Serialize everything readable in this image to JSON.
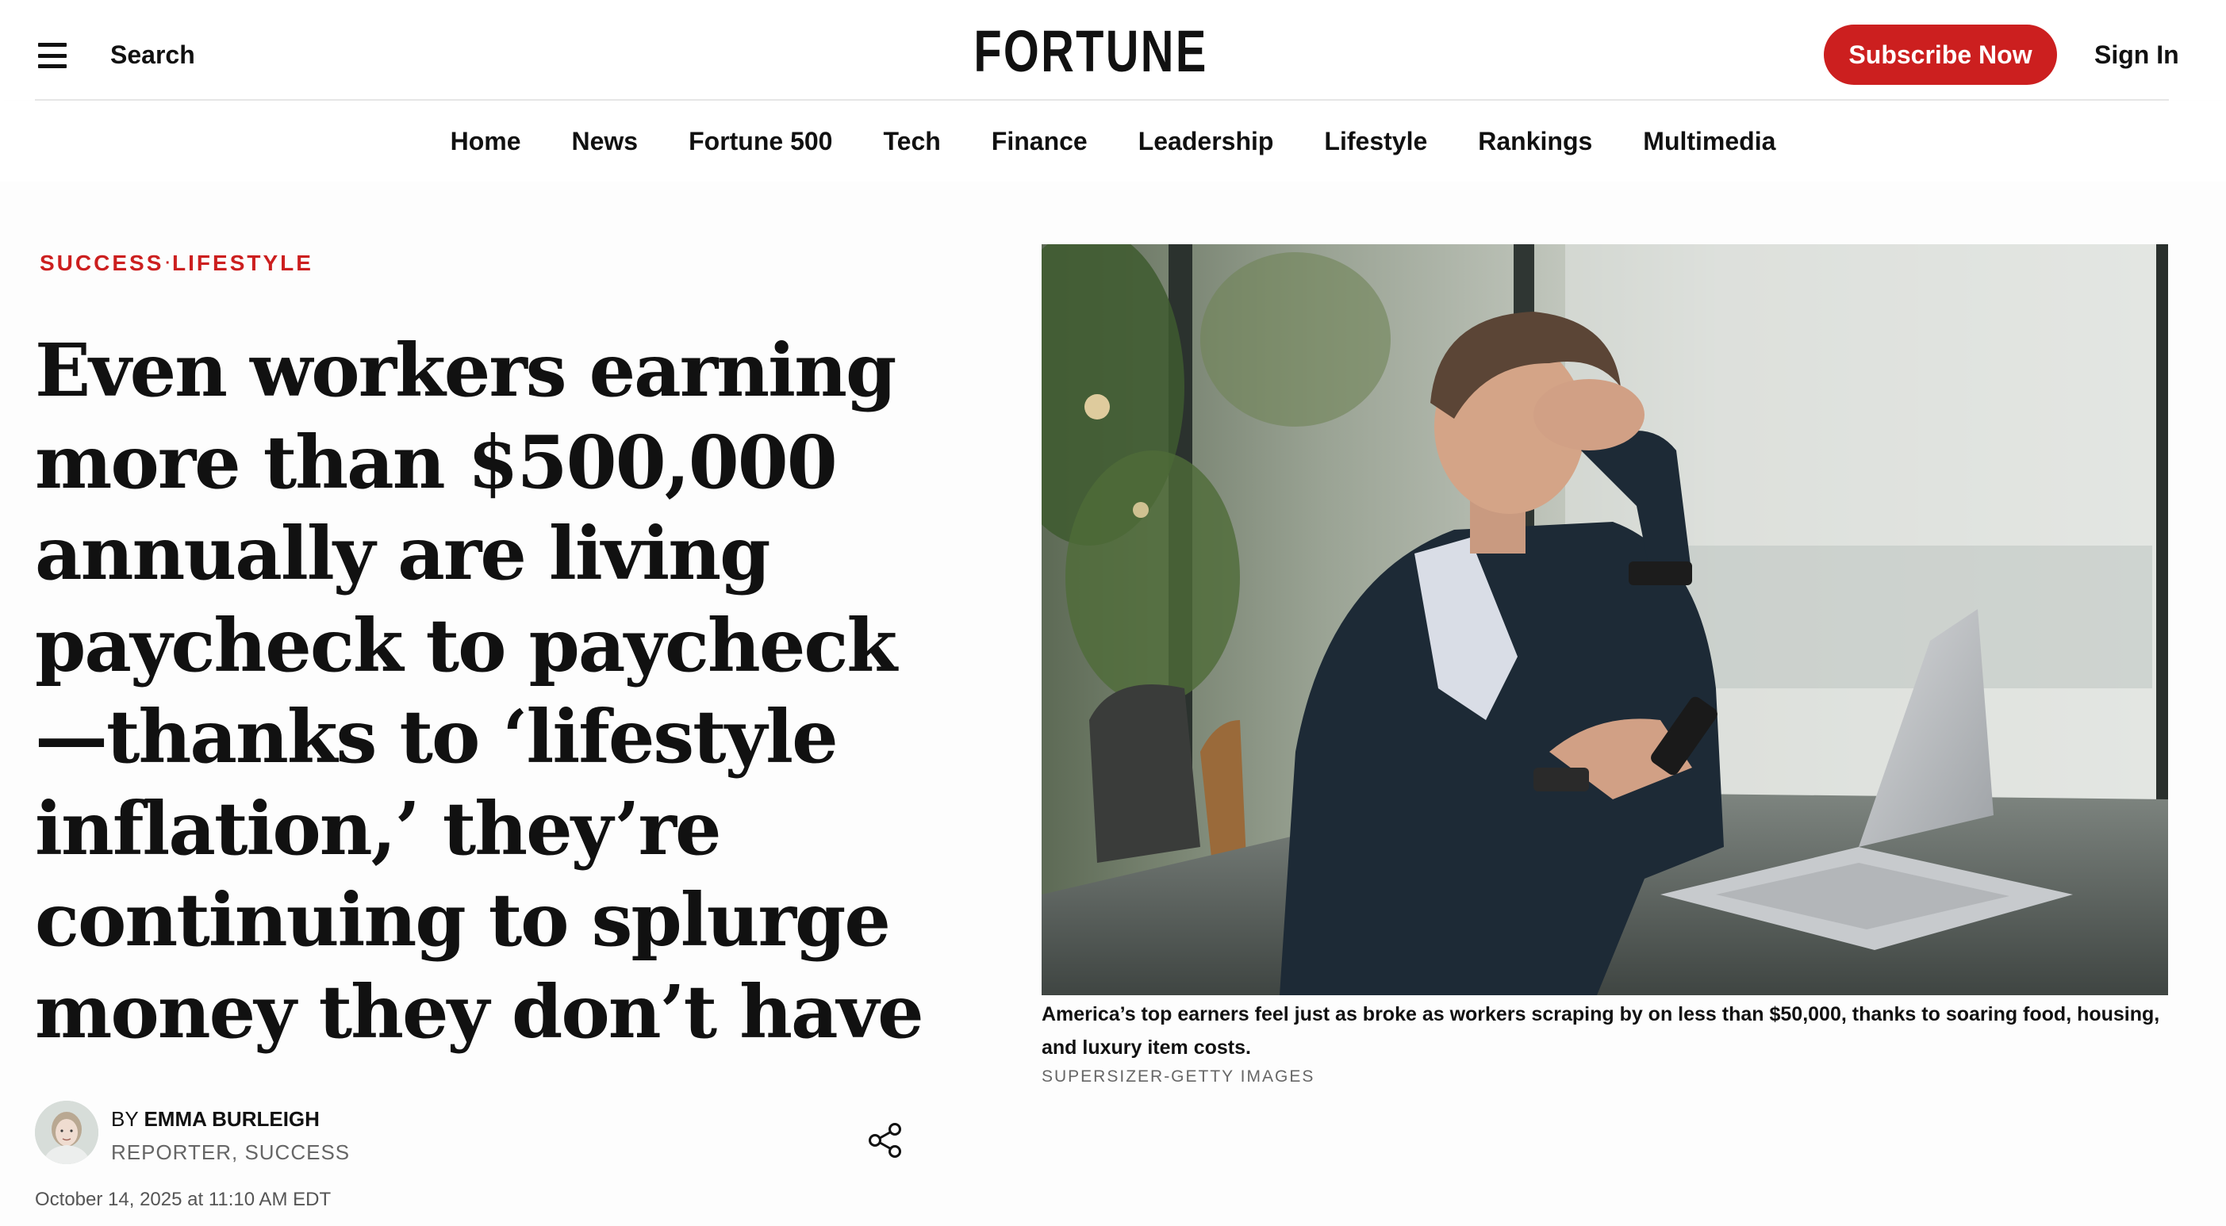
{
  "header": {
    "search_label": "Search",
    "logo_text": "FORTUNE",
    "subscribe_label": "Subscribe Now",
    "signin_label": "Sign In",
    "accent_color": "#cc1f1f"
  },
  "nav": {
    "items": [
      "Home",
      "News",
      "Fortune 500",
      "Tech",
      "Finance",
      "Leadership",
      "Lifestyle",
      "Rankings",
      "Multimedia"
    ]
  },
  "article": {
    "tags": [
      "SUCCESS",
      "LIFESTYLE"
    ],
    "tag_separator": "·",
    "headline": "Even workers earning more than $500,000 annually are living paycheck to paycheck—thanks to ‘lifestyle inflation,’ they’re continuing to splurge money they don’t have",
    "author": {
      "by_prefix": "BY",
      "name": "EMMA BURLEIGH",
      "role": "REPORTER, SUCCESS"
    },
    "timestamp": "October 14, 2025 at 11:10 AM EDT",
    "image": {
      "caption": "America’s top earners feel just as broke as workers scraping by on less than $50,000, thanks to soaring food, housing, and luxury item costs.",
      "credit": "SUPERSIZER-GETTY IMAGES"
    }
  },
  "icons": {
    "menu": "hamburger-menu-icon",
    "share": "share-icon"
  }
}
